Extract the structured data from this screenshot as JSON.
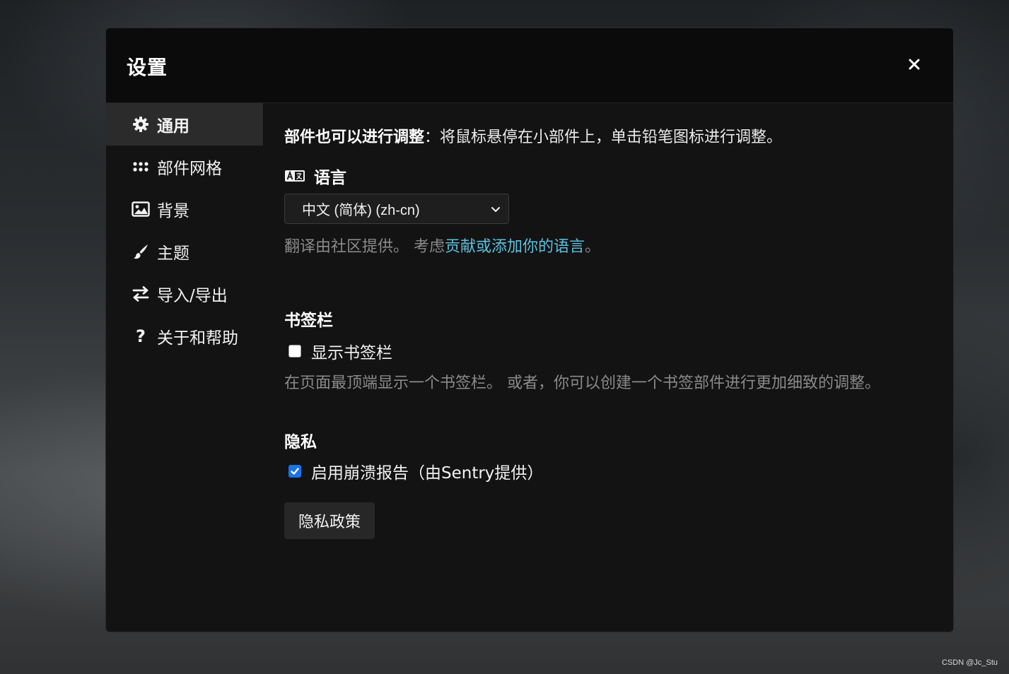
{
  "dialog": {
    "title": "设置",
    "close_icon": "close-icon"
  },
  "sidebar": {
    "items": [
      {
        "label": "通用",
        "icon": "gear-icon",
        "active": true
      },
      {
        "label": "部件网格",
        "icon": "grid-dots-icon",
        "active": false
      },
      {
        "label": "背景",
        "icon": "image-icon",
        "active": false
      },
      {
        "label": "主题",
        "icon": "paintbrush-icon",
        "active": false
      },
      {
        "label": "导入/导出",
        "icon": "swap-arrows-icon",
        "active": false
      },
      {
        "label": "关于和帮助",
        "icon": "question-icon",
        "active": false
      }
    ],
    "question_glyph": "?"
  },
  "general": {
    "tip_strong": "部件也可以进行调整",
    "tip_rest": "：将鼠标悬停在小部件上，单击铅笔图标进行调整。",
    "language": {
      "heading": "语言",
      "icon": "translate-icon",
      "selected": "中文 (简体) (zh-cn)",
      "note_prefix": "翻译由社区提供。 考虑",
      "note_link": "贡献或添加你的语言",
      "note_suffix": "。"
    },
    "bookmarks": {
      "heading": "书签栏",
      "checkbox_label": "显示书签栏",
      "checked": false,
      "description": "在页面最顶端显示一个书签栏。 或者，你可以创建一个书签部件进行更加细致的调整。"
    },
    "privacy": {
      "heading": "隐私",
      "checkbox_label": "启用崩溃报告（由Sentry提供）",
      "checked": true,
      "policy_button": "隐私政策"
    }
  },
  "watermark": "CSDN @Jc_Stu",
  "colors": {
    "accent_link": "#5bc0de",
    "checkbox_checked": "#1a73e8",
    "modal_bg": "#131313",
    "header_bg": "#0b0b0b",
    "active_nav_bg": "#2b2b2b"
  }
}
